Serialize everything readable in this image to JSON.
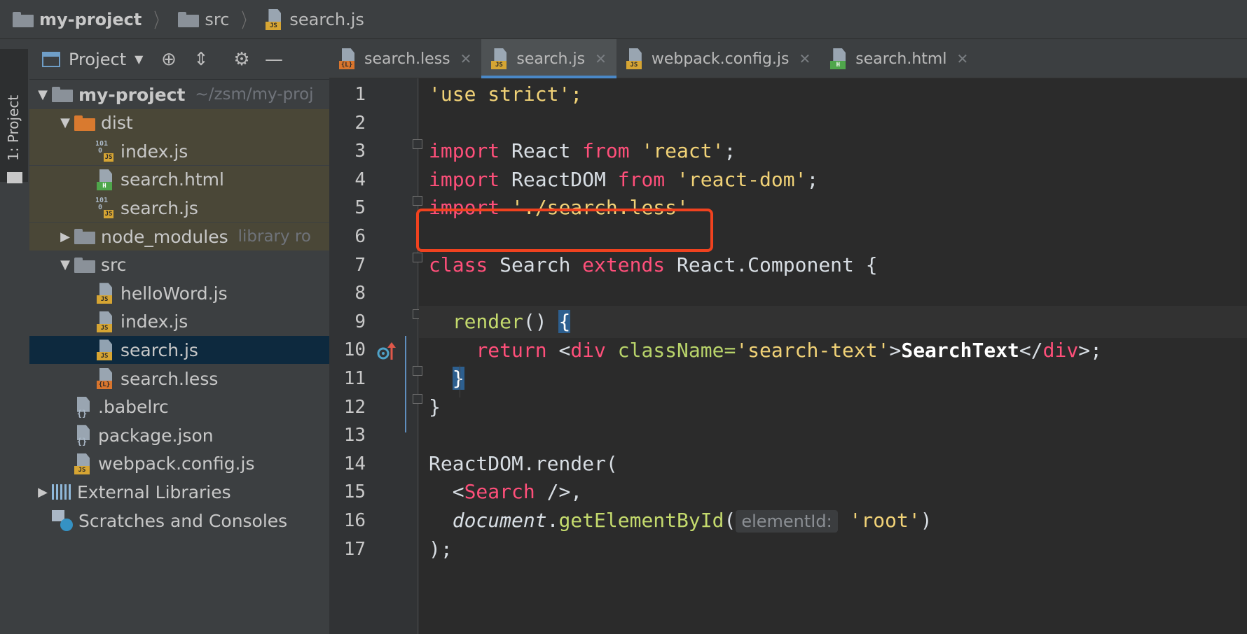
{
  "breadcrumb": [
    {
      "label": "my-project",
      "icon": "folder-icon"
    },
    {
      "label": "src",
      "icon": "folder-icon"
    },
    {
      "label": "search.js",
      "icon": "js-file-icon"
    }
  ],
  "toolwindow": {
    "label": "1: Project"
  },
  "panel": {
    "title": "Project"
  },
  "tree": [
    {
      "label": "my-project",
      "hint": "~/zsm/my-proj",
      "arrow": "▼",
      "icon": "folder",
      "indent": 0,
      "bold": true
    },
    {
      "label": "dist",
      "arrow": "▼",
      "icon": "folder-orange",
      "indent": 1,
      "ochre": true
    },
    {
      "label": "index.js",
      "icon": "bin-js",
      "indent": 2,
      "ochre": true
    },
    {
      "label": "search.html",
      "icon": "html",
      "indent": 2,
      "ochre": true
    },
    {
      "label": "search.js",
      "icon": "bin-js",
      "indent": 2,
      "ochre": true
    },
    {
      "label": "node_modules",
      "hint": "library ro",
      "arrow": "▶",
      "icon": "folder",
      "indent": 1,
      "ochre": true
    },
    {
      "label": "src",
      "arrow": "▼",
      "icon": "folder",
      "indent": 1
    },
    {
      "label": "helloWord.js",
      "icon": "js",
      "indent": 2
    },
    {
      "label": "index.js",
      "icon": "js",
      "indent": 2
    },
    {
      "label": "search.js",
      "icon": "js",
      "indent": 2,
      "selected": true
    },
    {
      "label": "search.less",
      "icon": "less",
      "indent": 2
    },
    {
      "label": ".babelrc",
      "icon": "cfg",
      "indent": 1
    },
    {
      "label": "package.json",
      "icon": "cfg",
      "indent": 1
    },
    {
      "label": "webpack.config.js",
      "icon": "js",
      "indent": 1
    },
    {
      "label": "External Libraries",
      "arrow": "▶",
      "icon": "lib",
      "indent": 0
    },
    {
      "label": "Scratches and Consoles",
      "icon": "scratch",
      "indent": 0
    }
  ],
  "tabs": [
    {
      "label": "search.less",
      "icon": "less"
    },
    {
      "label": "search.js",
      "icon": "js",
      "active": true
    },
    {
      "label": "webpack.config.js",
      "icon": "js"
    },
    {
      "label": "search.html",
      "icon": "html"
    }
  ],
  "code": {
    "line_numbers": [
      "1",
      "2",
      "3",
      "4",
      "5",
      "6",
      "7",
      "8",
      "9",
      "10",
      "11",
      "12",
      "13",
      "14",
      "15",
      "16",
      "17"
    ],
    "l1": "'use strict';",
    "l3": {
      "kw1": "import",
      "id": " React ",
      "kw2": "from",
      "str": " 'react'",
      "end": ";"
    },
    "l4": {
      "kw1": "import",
      "id": " ReactDOM ",
      "kw2": "from",
      "str": " 'react-dom'",
      "end": ";"
    },
    "l5": {
      "kw1": "import",
      "str": " './search.less'"
    },
    "l7": {
      "kw1": "class",
      "id": " Search ",
      "kw2": "extends",
      "rest": " React.Component {"
    },
    "l9": {
      "fn": "render",
      "paren": "() ",
      "brace": "{"
    },
    "l10": {
      "kw": "return",
      "lt": " <",
      "tag1": "div",
      "attr": " className=",
      "str": "'search-text'",
      "gt": ">",
      "text": "SearchText",
      "close": "</",
      "tag2": "div",
      "end": ">;"
    },
    "l11": {
      "brace": "}"
    },
    "l12": "}",
    "l14": "ReactDOM.render(",
    "l15": {
      "lt": "<",
      "tag": "Search",
      "end": " />,"
    },
    "l16": {
      "obj": "document",
      "dot": ".",
      "fn": "getElementById",
      "paren": "(",
      "hint": "elementId:",
      "str": "'root'",
      "end": ")"
    },
    "l17": ");"
  },
  "colors": {
    "highlight_box": "#f0421f",
    "selection": "#0d293e",
    "accent": "#4a88c7"
  }
}
